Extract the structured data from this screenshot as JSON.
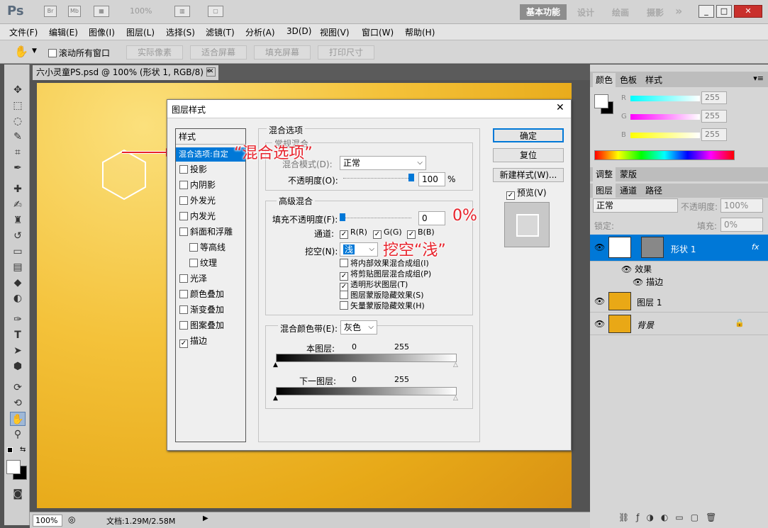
{
  "titlebar": {
    "logo": "Ps",
    "br": "Br",
    "mb": "Mb",
    "zoom": "100%",
    "workspace_active": "基本功能",
    "workspaces": [
      "设计",
      "绘画",
      "摄影"
    ],
    "more": "»",
    "win_min": "_",
    "win_max": "□",
    "win_close": "✕"
  },
  "menu": [
    "文件(F)",
    "编辑(E)",
    "图像(I)",
    "图层(L)",
    "选择(S)",
    "滤镜(T)",
    "分析(A)",
    "3D(D)",
    "视图(V)",
    "窗口(W)",
    "帮助(H)"
  ],
  "options": {
    "scroll_all": "滚动所有窗口",
    "buttons": [
      "实际像素",
      "适合屏幕",
      "填充屏幕",
      "打印尺寸"
    ]
  },
  "document": {
    "tab": "六小灵童PS.psd @ 100% (形状 1, RGB/8) *",
    "tab_close": "✕"
  },
  "status": {
    "zoom": "100%",
    "doc": "文档:1.29M/2.58M"
  },
  "dialog": {
    "title": "图层样式",
    "close": "✕",
    "styles_header": "样式",
    "styles": [
      {
        "label": "混合选项:自定",
        "type": "header",
        "selected": true
      },
      {
        "label": "投影",
        "checked": false
      },
      {
        "label": "内阴影",
        "checked": false
      },
      {
        "label": "外发光",
        "checked": false
      },
      {
        "label": "内发光",
        "checked": false
      },
      {
        "label": "斜面和浮雕",
        "checked": false
      },
      {
        "label": "等高线",
        "checked": false,
        "indent": true
      },
      {
        "label": "纹理",
        "checked": false,
        "indent": true
      },
      {
        "label": "光泽",
        "checked": false
      },
      {
        "label": "颜色叠加",
        "checked": false
      },
      {
        "label": "渐变叠加",
        "checked": false
      },
      {
        "label": "图案叠加",
        "checked": false
      },
      {
        "label": "描边",
        "checked": true
      }
    ],
    "blend_section": "混合选项",
    "general_legend": "常规混合",
    "blend_mode_label": "混合模式(D):",
    "blend_mode_value": "正常",
    "opacity_label": "不透明度(O):",
    "opacity_value": "100",
    "opacity_unit": "%",
    "advanced_legend": "高级混合",
    "fill_opacity_label": "填充不透明度(F):",
    "fill_opacity_value": "0",
    "channels_label": "通道:",
    "channels": [
      "R(R)",
      "G(G)",
      "B(B)"
    ],
    "knockout_label": "挖空(N):",
    "knockout_value": "浅",
    "advanced_options": [
      {
        "label": "将内部效果混合成组(I)",
        "checked": false
      },
      {
        "label": "将剪贴图层混合成组(P)",
        "checked": true
      },
      {
        "label": "透明形状图层(T)",
        "checked": true
      },
      {
        "label": "图层蒙版隐藏效果(S)",
        "checked": false
      },
      {
        "label": "矢量蒙版隐藏效果(H)",
        "checked": false
      }
    ],
    "blendif_label": "混合颜色带(E):",
    "blendif_value": "灰色",
    "this_layer": "本图层:",
    "this_layer_low": "0",
    "this_layer_high": "255",
    "below_layer": "下一图层:",
    "below_layer_low": "0",
    "below_layer_high": "255",
    "ok": "确定",
    "reset": "复位",
    "new_style": "新建样式(W)...",
    "preview": "预览(V)"
  },
  "annotations": {
    "blend": "“混合选项”",
    "zero": "0%",
    "knockout": "挖空“浅”"
  },
  "panel": {
    "color_tabs": [
      "颜色",
      "色板",
      "样式"
    ],
    "r": "R",
    "g": "G",
    "b": "B",
    "r_val": "255",
    "g_val": "255",
    "b_val": "255",
    "adj_tabs": [
      "调整",
      "蒙版"
    ],
    "layer_tabs": [
      "图层",
      "通道",
      "路径"
    ],
    "layer_blend": "正常",
    "layer_opacity_label": "不透明度:",
    "layer_opacity": "100%",
    "lock_label": "锁定:",
    "fill_label": "填充:",
    "fill_value": "0%",
    "layers": [
      {
        "name": "形状 1",
        "selected": true
      },
      {
        "name": "图层 1"
      },
      {
        "name": "背景"
      }
    ],
    "effects": "效果",
    "stroke": "描边"
  },
  "colors": {
    "accent": "#0078d7",
    "annotation": "#e8232c"
  }
}
